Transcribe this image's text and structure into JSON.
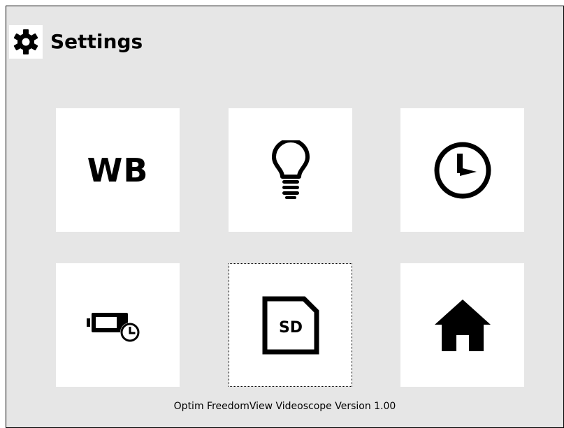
{
  "header": {
    "title": "Settings",
    "icon": "gear-icon"
  },
  "tiles": [
    {
      "label": "WB",
      "icon": "white-balance-text"
    },
    {
      "icon": "lightbulb-icon"
    },
    {
      "icon": "clock-icon"
    },
    {
      "icon": "battery-timer-icon"
    },
    {
      "icon": "sd-card-icon",
      "sd_label": "SD"
    },
    {
      "icon": "home-icon"
    }
  ],
  "footer": {
    "version_text": "Optim FreedomView Videoscope Version 1.00"
  },
  "colors": {
    "background": "#e6e6e6",
    "tile": "#ffffff",
    "ink": "#000000"
  }
}
